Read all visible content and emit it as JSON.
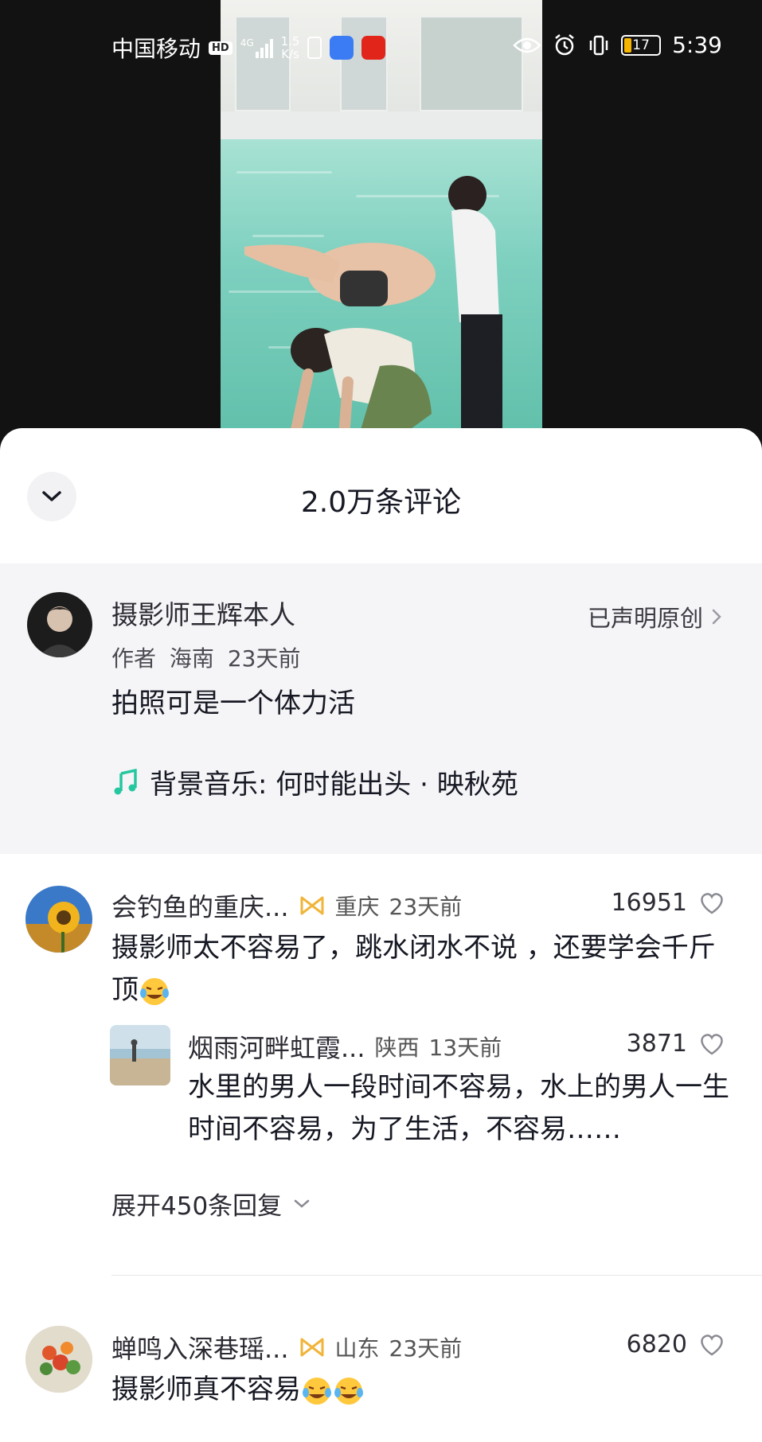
{
  "status_bar": {
    "carrier": "中国移动",
    "hd": "HD",
    "network": "4G",
    "speed_value": "1.5",
    "speed_unit": "K/s",
    "battery": "17",
    "time": "5:39"
  },
  "comments_panel": {
    "title": "2.0万条评论",
    "author_post": {
      "name": "摄影师王辉本人",
      "role": "作者",
      "location": "海南",
      "time": "23天前",
      "original_label": "已声明原创",
      "text": "拍照可是一个体力活",
      "music_prefix": "背景音乐: ",
      "music_title": "何时能出头 · 映秋苑"
    },
    "comments": [
      {
        "username": "会钓鱼的重庆...",
        "location": "重庆",
        "time": "23天前",
        "likes": "16951",
        "text": "摄影师太不容易了，跳水闭水不说 ，还要学会千斤顶",
        "emoji": "crying-laughing-emoji",
        "reply": {
          "username": "烟雨河畔虹霞...",
          "location": "陕西",
          "time": "13天前",
          "likes": "3871",
          "text": "水里的男人一段时间不容易，水上的男人一生时间不容易，为了生活，不容易……"
        },
        "expand_label": "展开450条回复"
      },
      {
        "username": "蝉鸣入深巷瑶...",
        "location": "山东",
        "time": "23天前",
        "likes": "6820",
        "text": "摄影师真不容易",
        "emoji": "crying-laughing-emoji"
      }
    ]
  },
  "colors": {
    "music_green": "#25c7a0",
    "badge_gold": "#f0b53a",
    "battery_fill": "#f5b400"
  },
  "icons": [
    "collapse-chevron-icon",
    "chevron-right-icon",
    "music-note-icon",
    "bow-badge-icon",
    "heart-icon",
    "chevron-down-icon",
    "eye-icon",
    "alarm-icon",
    "vibrate-icon"
  ]
}
